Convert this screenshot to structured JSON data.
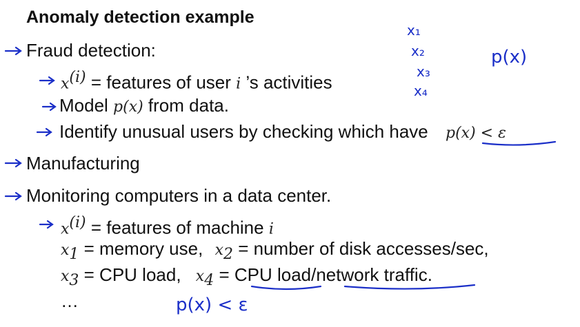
{
  "title": "Anomaly detection example",
  "bullets": {
    "fraud": "Fraud detection:",
    "fraud_features_math": "x",
    "fraud_features_sup": "(i)",
    "fraud_features_text": " = features of user ",
    "fraud_features_i": "i",
    "fraud_features_tail": " ’s activities",
    "model_text": "Model ",
    "model_math": "p(x)",
    "model_tail": " from data.",
    "identify_text": "Identify unusual users by checking which have",
    "identify_math": "p(x) < ε",
    "manufacturing": "Manufacturing",
    "monitoring": "Monitoring computers in a data center.",
    "machine_math": "x",
    "machine_sup": "(i)",
    "machine_text": " = features of machine ",
    "machine_i": "i",
    "x1": "x",
    "x1_sub": "1",
    "x1_text": " = memory use,",
    "x2": "x",
    "x2_sub": "2",
    "x2_text": " = number of disk accesses/sec,",
    "x3": "x",
    "x3_sub": "3",
    "x3_text": " = CPU load,",
    "x4": "x",
    "x4_sub": "4",
    "x4_text": " = CPU load/network traffic.",
    "ellipsis": "…"
  },
  "handwriting": {
    "x1": "x₁",
    "x2": "x₂",
    "x3": "x₃",
    "x4": "x₄",
    "px": "p(x)",
    "px_eps": "p(x) < ε"
  },
  "colors": {
    "ink": "#1b2fc8"
  }
}
